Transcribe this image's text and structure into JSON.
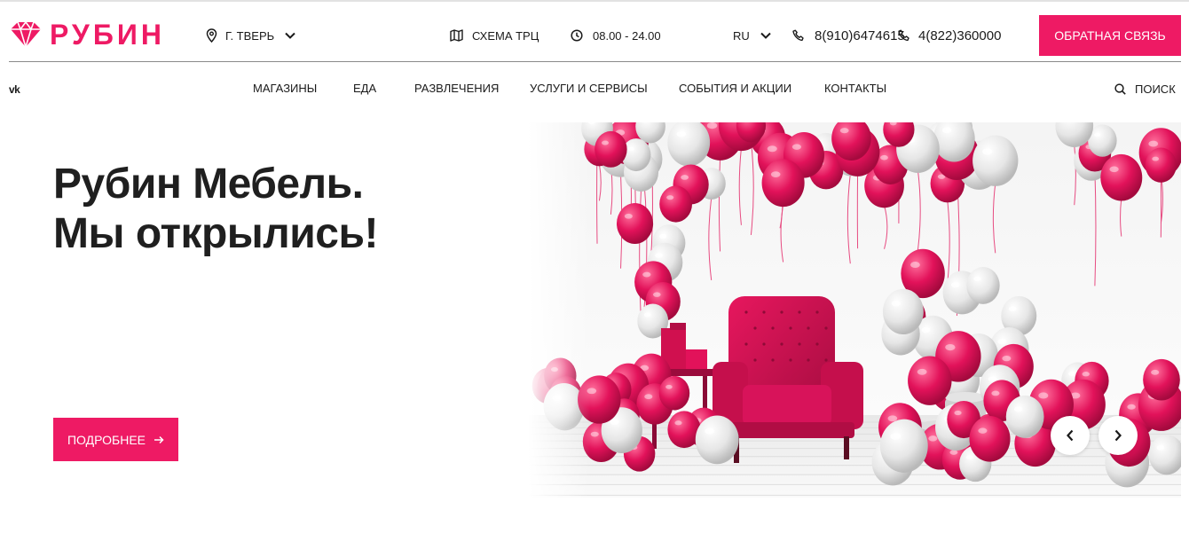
{
  "brand": {
    "name": "РУБИН",
    "accent_color": "#ee1a64",
    "logo_icon": "ruby-gem-icon"
  },
  "header": {
    "city": "г. Тверь",
    "scheme": "Схема ТРЦ",
    "hours": "08.00 - 24.00",
    "language": "RU",
    "phone_1": "8(910)6474615",
    "phone_2": "4(822)360000",
    "feedback_button": "Обратная связь",
    "icons": [
      "map-pin-icon",
      "chevron-down-icon",
      "map-icon",
      "clock-icon",
      "phone-icon"
    ]
  },
  "nav": {
    "social": "vk-icon",
    "items": [
      {
        "label": "Магазины"
      },
      {
        "label": "Еда"
      },
      {
        "label": "Развлечения"
      },
      {
        "label": "Услуги и сервисы"
      },
      {
        "label": "События и акции"
      },
      {
        "label": "Контакты"
      }
    ],
    "search_label": "Поиск"
  },
  "hero": {
    "title_line_1": "Рубин Мебель.",
    "title_line_2": "Мы открылись!",
    "button_label": "Подробнее",
    "image_alt": "hero-balloons-armchair-image",
    "slider_controls": [
      "chevron-left-icon",
      "chevron-right-icon"
    ]
  }
}
